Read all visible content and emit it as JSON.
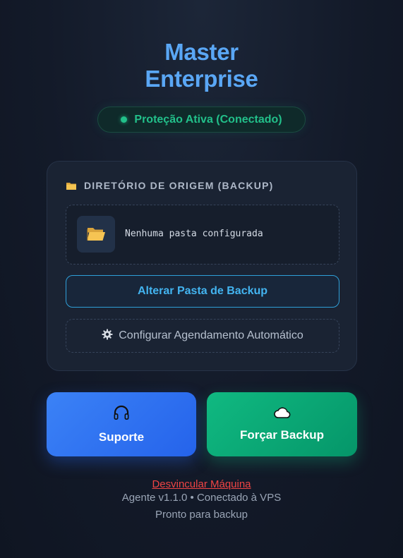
{
  "header": {
    "title_line1": "Master",
    "title_line2": "Enterprise"
  },
  "status": {
    "label": "Proteção Ativa (Conectado)",
    "color": "#22c08a"
  },
  "source_card": {
    "label": "DIRETÓRIO DE ORIGEM (BACKUP)",
    "label_icon": "folder-icon",
    "folder_path": "Nenhuma pasta configurada",
    "folder_icon": "folder-open-icon",
    "change_button": "Alterar Pasta de Backup",
    "schedule_button": "Configurar Agendamento Automático",
    "schedule_icon": "gear-icon"
  },
  "actions": {
    "support": {
      "label": "Suporte",
      "icon": "headset-icon",
      "color": "#3b82f6"
    },
    "force_backup": {
      "label": "Forçar Backup",
      "icon": "cloud-icon",
      "color": "#10b981"
    }
  },
  "footer": {
    "unlink": "Desvincular Máquina",
    "version": "Agente v1.1.0 • Conectado à VPS",
    "state": "Pronto para backup"
  },
  "colors": {
    "accent": "#5aa7f5",
    "danger": "#ef4444"
  }
}
